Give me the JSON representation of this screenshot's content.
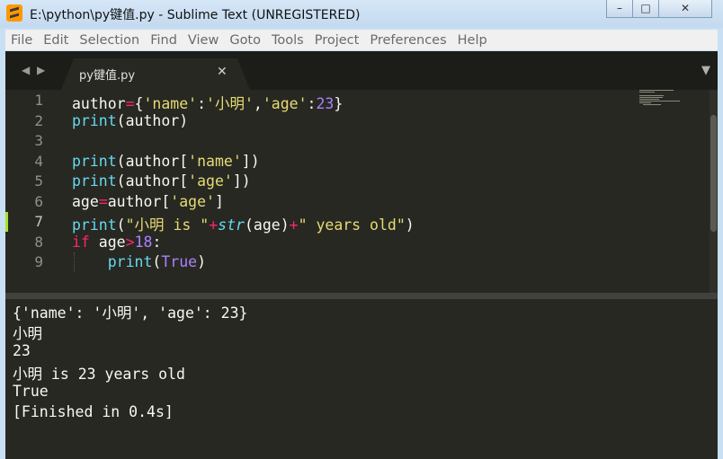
{
  "window": {
    "title": "E:\\python\\py键值.py - Sublime Text (UNREGISTERED)",
    "minimize_glyph": "–",
    "maximize_glyph": "□",
    "close_glyph": "✕"
  },
  "menu": [
    "File",
    "Edit",
    "Selection",
    "Find",
    "View",
    "Goto",
    "Tools",
    "Project",
    "Preferences",
    "Help"
  ],
  "tabs": {
    "nav_arrows": "◀ ▶",
    "active_tab": "py键值.py",
    "close_glyph": "✕",
    "dropdown_glyph": "▼"
  },
  "editor": {
    "line_numbers": [
      "1",
      "2",
      "3",
      "4",
      "5",
      "6",
      "7",
      "8",
      "9"
    ],
    "active_line": 7,
    "code": [
      [
        [
          "author",
          ""
        ],
        [
          "=",
          "kw"
        ],
        [
          "{",
          ""
        ],
        [
          "'name'",
          "str"
        ],
        [
          ":",
          ""
        ],
        [
          "'小明'",
          "str"
        ],
        [
          ",",
          ""
        ],
        [
          "'age'",
          "str"
        ],
        [
          ":",
          ""
        ],
        [
          "23",
          "num"
        ],
        [
          "}",
          ""
        ]
      ],
      [
        [
          "print",
          "fn"
        ],
        [
          "(author)",
          ""
        ]
      ],
      [],
      [
        [
          "print",
          "fn"
        ],
        [
          "(author[",
          ""
        ],
        [
          "'name'",
          "str"
        ],
        [
          "])",
          ""
        ]
      ],
      [
        [
          "print",
          "fn"
        ],
        [
          "(author[",
          ""
        ],
        [
          "'age'",
          "str"
        ],
        [
          "])",
          ""
        ]
      ],
      [
        [
          "age",
          ""
        ],
        [
          "=",
          "kw"
        ],
        [
          "author[",
          ""
        ],
        [
          "'age'",
          "str"
        ],
        [
          "]",
          ""
        ]
      ],
      [
        [
          "print",
          "fn"
        ],
        [
          "(",
          ""
        ],
        [
          "\"小明 is \"",
          "str"
        ],
        [
          "+",
          "kw"
        ],
        [
          "str",
          "fn-i"
        ],
        [
          "(age)",
          ""
        ],
        [
          "+",
          "kw"
        ],
        [
          "\" years old\"",
          "str"
        ],
        [
          ")",
          ""
        ]
      ],
      [
        [
          "if",
          "kw"
        ],
        [
          " age",
          ""
        ],
        [
          ">",
          "kw"
        ],
        [
          "18",
          "num"
        ],
        [
          ":",
          ""
        ]
      ],
      [
        [
          "    ",
          ""
        ],
        [
          "print",
          "fn"
        ],
        [
          "(",
          ""
        ],
        [
          "True",
          "num"
        ],
        [
          ")",
          ""
        ]
      ]
    ]
  },
  "output": {
    "lines": [
      "{'name': '小明', 'age': 23}",
      "小明",
      "23",
      "小明 is 23 years old",
      "True",
      "[Finished in 0.4s]"
    ]
  },
  "colors": {
    "background": "#272822",
    "keyword": "#f92672",
    "string": "#e6db74",
    "number": "#ae81ff",
    "function": "#66d9ef",
    "modified_marker": "#a6e22e"
  }
}
